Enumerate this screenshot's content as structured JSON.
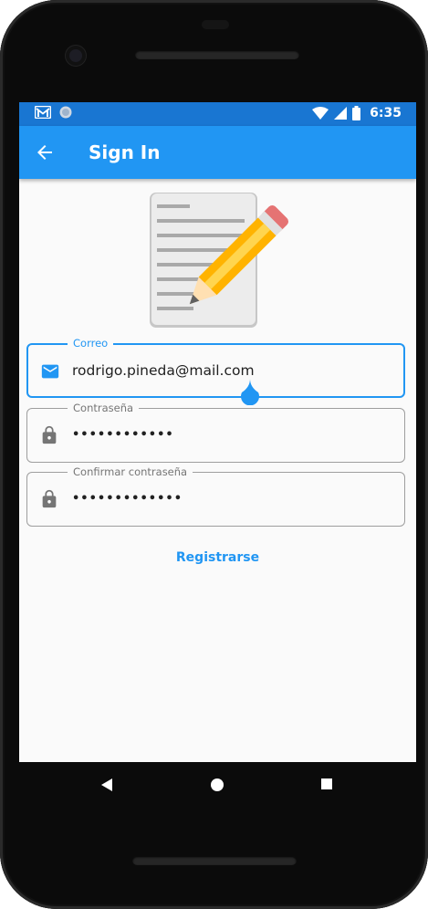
{
  "status_bar": {
    "time": "6:35",
    "icons": [
      "gmail-icon",
      "sync-dot-icon",
      "wifi-icon",
      "signal-icon",
      "battery-icon"
    ]
  },
  "app_bar": {
    "title": "Sign In",
    "back_icon": "arrow-back-icon"
  },
  "hero": {
    "icon": "notepad-pencil-illustration"
  },
  "form": {
    "email": {
      "label": "Correo",
      "value": "rodrigo.pineda@mail.com",
      "icon": "email-icon"
    },
    "password": {
      "label": "Contraseña",
      "value": "••••••••••••",
      "icon": "lock-icon"
    },
    "confirm_password": {
      "label": "Confirmar contraseña",
      "value": "•••••••••••••",
      "icon": "lock-icon"
    },
    "submit_label": "Registrarse"
  },
  "nav_bar": {
    "icons": [
      "back-triangle-icon",
      "home-circle-icon",
      "recents-square-icon"
    ]
  },
  "colors": {
    "primary": "#2196f3",
    "primary_dark": "#1976d2",
    "background": "#fafafa",
    "border": "#9e9e9e"
  }
}
